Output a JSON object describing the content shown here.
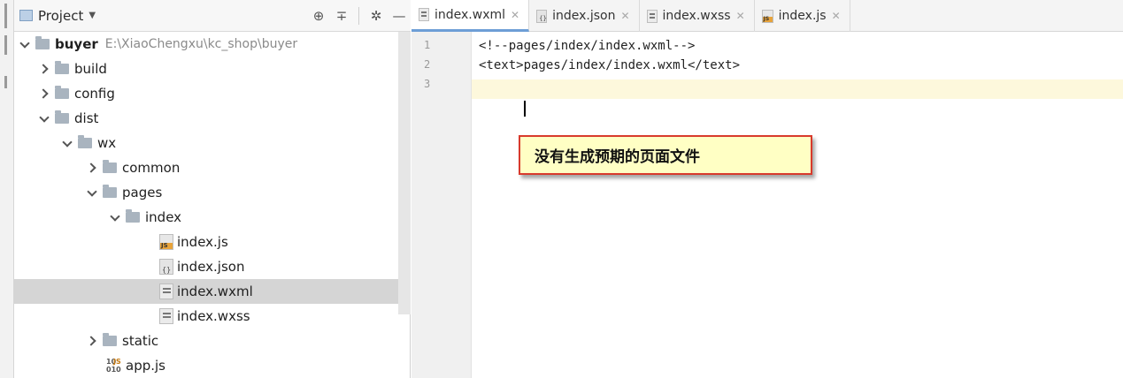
{
  "project_panel": {
    "title": "Project",
    "tree": [
      {
        "label": "buyer",
        "path": "E:\\XiaoChengxu\\kc_shop\\buyer"
      },
      {
        "label": "build"
      },
      {
        "label": "config"
      },
      {
        "label": "dist"
      },
      {
        "label": "wx"
      },
      {
        "label": "common"
      },
      {
        "label": "pages"
      },
      {
        "label": "index"
      },
      {
        "label": "index.js"
      },
      {
        "label": "index.json"
      },
      {
        "label": "index.wxml"
      },
      {
        "label": "index.wxss"
      },
      {
        "label": "static"
      },
      {
        "label": "app.js"
      }
    ]
  },
  "editor": {
    "tabs": [
      {
        "label": "index.wxml"
      },
      {
        "label": "index.json"
      },
      {
        "label": "index.wxss"
      },
      {
        "label": "index.js"
      }
    ],
    "line_numbers": [
      "1",
      "2",
      "3"
    ],
    "lines": [
      "<!--pages/index/index.wxml-->",
      "<text>pages/index/index.wxml</text>",
      ""
    ],
    "annotation": "没有生成预期的页面文件"
  },
  "icons": {
    "locate": "crosshair-icon",
    "collapse": "collapse-icon",
    "settings": "gear-icon",
    "hide": "minimize-icon"
  },
  "colors": {
    "annotation_border": "#d83a2c",
    "annotation_fill": "#ffffc4",
    "selected_row": "#d5d5d5",
    "current_line": "#fdf8dc"
  }
}
